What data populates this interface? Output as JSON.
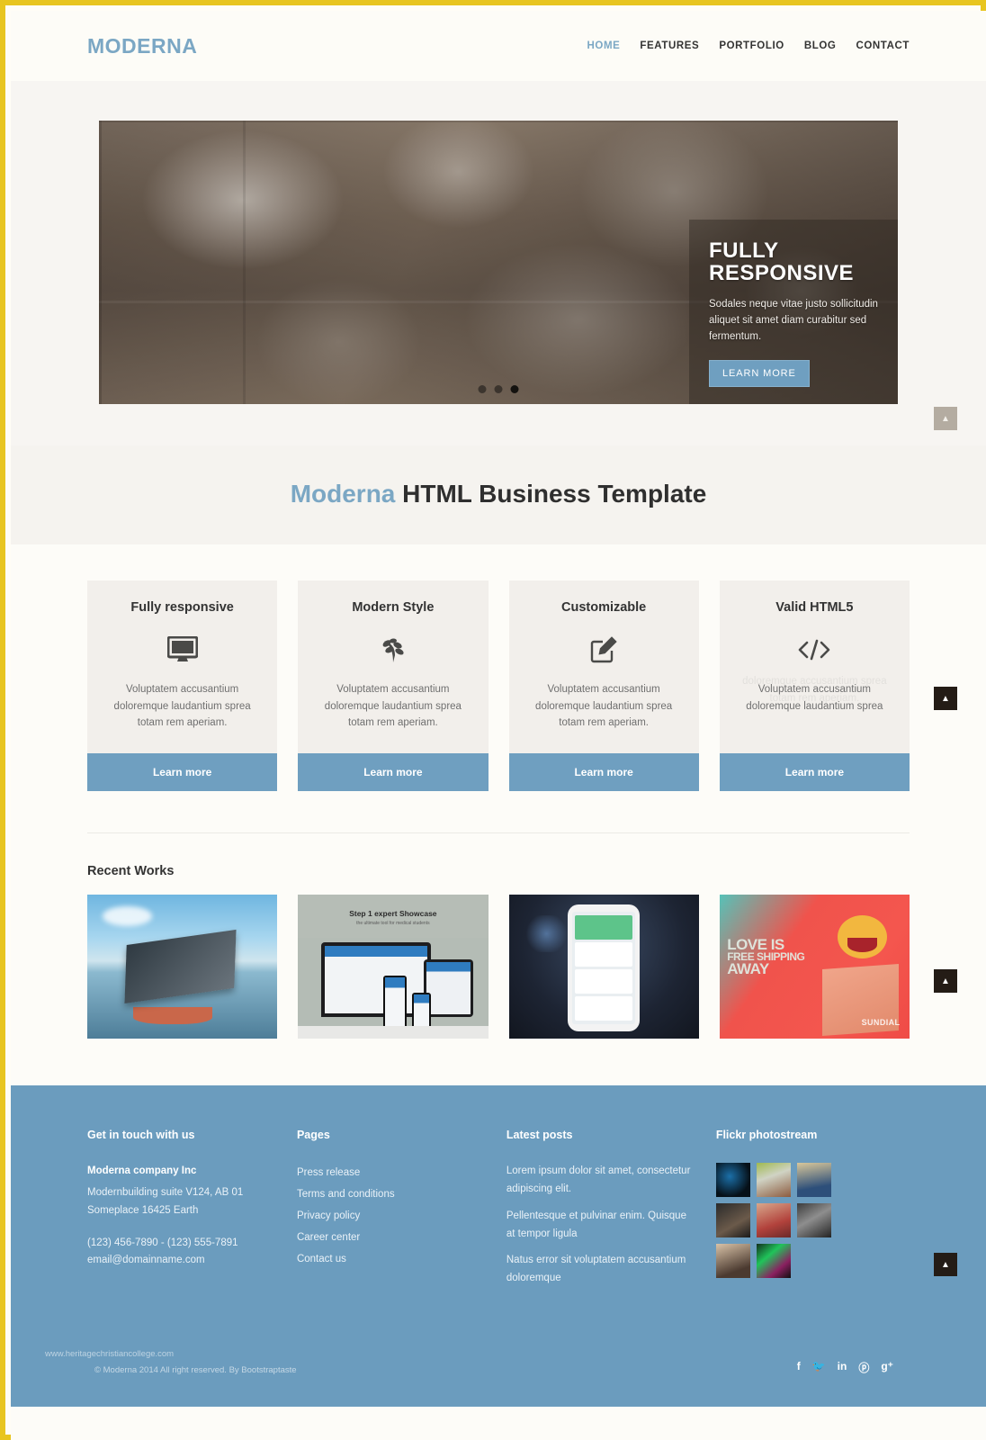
{
  "header": {
    "logo": "MODERNA",
    "nav": [
      {
        "label": "HOME",
        "active": true
      },
      {
        "label": "FEATURES",
        "active": false
      },
      {
        "label": "PORTFOLIO",
        "active": false
      },
      {
        "label": "BLOG",
        "active": false
      },
      {
        "label": "CONTACT",
        "active": false
      }
    ]
  },
  "slider": {
    "caption_title": "FULLY RESPONSIVE",
    "caption_text": "Sodales neque vitae justo sollicitudin aliquet sit amet diam curabitur sed fermentum.",
    "button_label": "LEARN MORE",
    "prev_label": "‹",
    "next_label": "›",
    "dots": 3,
    "active_dot": 2
  },
  "section_title": {
    "accent": "Moderna",
    "rest": " HTML Business Template"
  },
  "features": [
    {
      "title": "Fully responsive",
      "icon": "monitor-icon",
      "text": "Voluptatem accusantium doloremque laudantium sprea totam rem aperiam.",
      "ghost_text": "",
      "button": "Learn more"
    },
    {
      "title": "Modern Style",
      "icon": "leaf-icon",
      "text": "Voluptatem accusantium doloremque laudantium sprea totam rem aperiam.",
      "ghost_text": "",
      "button": "Learn more"
    },
    {
      "title": "Customizable",
      "icon": "pencil-square-icon",
      "text": "Voluptatem accusantium doloremque laudantium sprea totam rem aperiam.",
      "ghost_text": "",
      "button": "Learn more"
    },
    {
      "title": "Valid HTML5",
      "icon": "code-icon",
      "text": "Voluptatem accusantium doloremque laudantium sprea",
      "ghost_text": "doloremque accusantium sprea totam rem aperiam.",
      "button": "Learn more"
    }
  ],
  "works": {
    "heading": "Recent Works",
    "items": [
      {
        "name": "lake-boat-tablet-photo"
      },
      {
        "name": "step-1-expert-showcase",
        "title": "Step 1 expert Showcase",
        "subtitle": "the ultimate tool for medical students"
      },
      {
        "name": "iphone-health-app-mockup"
      },
      {
        "name": "love-is-free-shipping-away",
        "line1": "LOVE IS",
        "line2": "FREE SHIPPING",
        "line3": "AWAY",
        "brand": "SUNDIAL"
      }
    ]
  },
  "footer": {
    "contact": {
      "heading": "Get in touch with us",
      "company": "Moderna company Inc",
      "address1": "Modernbuilding suite V124, AB 01",
      "address2": "Someplace 16425 Earth",
      "phone": "(123) 456-7890 - (123) 555-7891",
      "email": "email@domainname.com"
    },
    "pages": {
      "heading": "Pages",
      "links": [
        "Press release",
        "Terms and conditions",
        "Privacy policy",
        "Career center",
        "Contact us"
      ]
    },
    "posts": {
      "heading": "Latest posts",
      "items": [
        "Lorem ipsum dolor sit amet, consectetur adipiscing elit.",
        "Pellentesque et pulvinar enim. Quisque at tempor ligula",
        "Natus error sit voluptatem accusantium doloremque"
      ]
    },
    "flickr": {
      "heading": "Flickr photostream",
      "count": 8
    },
    "watermark": "www.heritagechristiancollege.com",
    "copyright": "© Moderna 2014 All right reserved. By Bootstraptaste",
    "socials": [
      "f",
      "🐦",
      "in",
      "ⓟ",
      "g⁺"
    ]
  },
  "scroll_top": {
    "label": "▲",
    "count": 4
  },
  "colors": {
    "accent": "#7ba7c4",
    "button": "#6f9fc0",
    "footer_bg": "#6b9cbe",
    "frame": "#e8c520"
  }
}
